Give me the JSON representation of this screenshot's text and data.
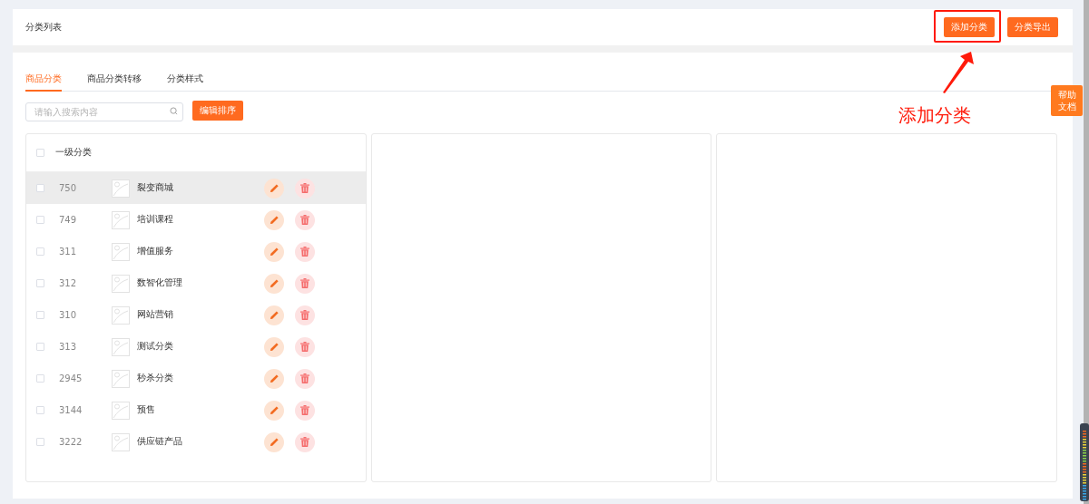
{
  "header": {
    "title": "分类列表",
    "buttons": [
      "添加分类",
      "分类导出"
    ]
  },
  "annotation": {
    "label": "添加分类"
  },
  "help": {
    "lines": [
      "帮助",
      "文档"
    ]
  },
  "tabs": [
    {
      "label": "商品分类",
      "selected": true
    },
    {
      "label": "商品分类转移",
      "selected": false
    },
    {
      "label": "分类样式",
      "selected": false
    }
  ],
  "search": {
    "placeholder": "请输入搜索内容"
  },
  "sort_button": "编辑排序",
  "list": {
    "header": {
      "label": "一级分类",
      "checked": false
    },
    "rows": [
      {
        "id": "750",
        "name": "裂变商城",
        "checked": false,
        "selected": true
      },
      {
        "id": "749",
        "name": "培训课程",
        "checked": false,
        "selected": false
      },
      {
        "id": "311",
        "name": "增值服务",
        "checked": false,
        "selected": false
      },
      {
        "id": "312",
        "name": "数智化管理",
        "checked": false,
        "selected": false
      },
      {
        "id": "310",
        "name": "网站营销",
        "checked": false,
        "selected": false
      },
      {
        "id": "313",
        "name": "测试分类",
        "checked": false,
        "selected": false
      },
      {
        "id": "2945",
        "name": "秒杀分类",
        "checked": false,
        "selected": false
      },
      {
        "id": "3144",
        "name": "预售",
        "checked": false,
        "selected": false
      },
      {
        "id": "3222",
        "name": "供应链产品",
        "checked": false,
        "selected": false
      }
    ]
  }
}
